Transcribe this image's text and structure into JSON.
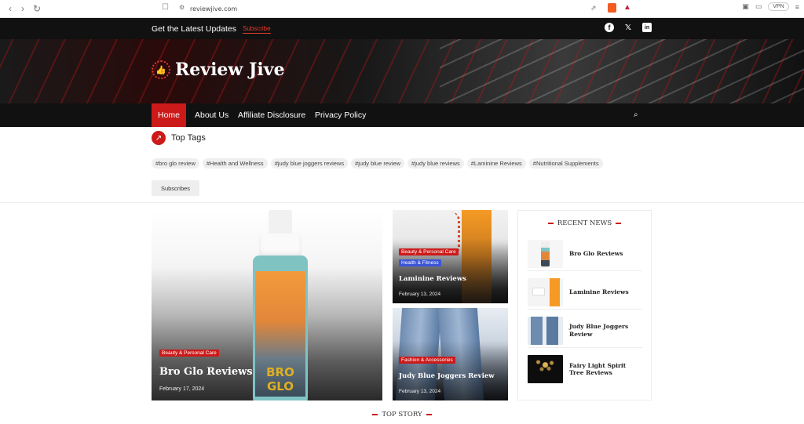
{
  "browser": {
    "url": "reviewjive.com",
    "vpn_label": "VPN"
  },
  "topbar": {
    "latest_label": "Get the Latest Updates",
    "subscribe_label": "Subscribe"
  },
  "social": {
    "facebook": "f",
    "x": "𝕏",
    "linkedin": "in"
  },
  "site": {
    "name": "Review Jive"
  },
  "nav": {
    "items": [
      "Home",
      "About Us",
      "Affiliate Disclosure",
      "Privacy Policy"
    ]
  },
  "tags": {
    "title": "Top Tags",
    "items": [
      "#bro glo review",
      "#Health and Wellness",
      "#judy blue joggers reviews",
      "#judy blue review",
      "#judy blue reviews",
      "#Laminine Reviews",
      "#Nutritional Supplements"
    ],
    "subscribes_label": "Subscribes"
  },
  "feature": {
    "category": "Beauty & Personal Care",
    "title": "Bro Glo Reviews",
    "date": "February 17, 2024",
    "product_brand": "BRO GLO"
  },
  "cards": [
    {
      "categories": [
        "Beauty & Personal Care",
        "Health & Fitness"
      ],
      "title": "Laminine Reviews",
      "date": "February 13, 2024"
    },
    {
      "categories": [
        "Fashion & Accessories"
      ],
      "title": "Judy Blue Joggers Review",
      "date": "February 13, 2024"
    }
  ],
  "recent_news": {
    "heading": "RECENT NEWS",
    "items": [
      "Bro Glo Reviews",
      "Laminine Reviews",
      "Judy Blue Joggers Review",
      "Fairy Light Spirit Tree Reviews"
    ]
  },
  "top_story": {
    "heading": "TOP STORY"
  },
  "colors": {
    "accent": "#cc1a1a",
    "header_bg": "#111111",
    "blue_badge": "#3b55d8"
  }
}
